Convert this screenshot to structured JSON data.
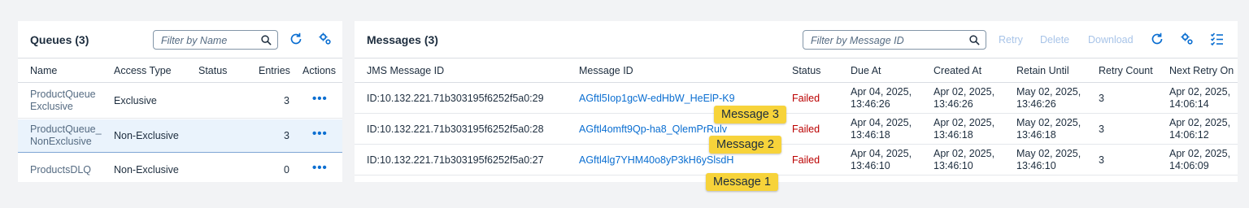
{
  "queues": {
    "title": "Queues (3)",
    "filter_placeholder": "Filter by Name",
    "columns": [
      "Name",
      "Access Type",
      "Status",
      "Entries",
      "Actions"
    ],
    "rows": [
      {
        "name_line1": "ProductQueue",
        "name_line2": "Exclusive",
        "access_type": "Exclusive",
        "status": "",
        "entries": "3",
        "actions": "•••"
      },
      {
        "name_line1": "ProductQueue_",
        "name_line2": "NonExclusive",
        "access_type": "Non-Exclusive",
        "status": "",
        "entries": "3",
        "actions": "•••"
      },
      {
        "name_line1": "ProductsDLQ",
        "name_line2": "",
        "access_type": "Non-Exclusive",
        "status": "",
        "entries": "0",
        "actions": "•••"
      }
    ]
  },
  "messages": {
    "title": "Messages (3)",
    "filter_placeholder": "Filter by Message ID",
    "actions": {
      "retry": "Retry",
      "delete": "Delete",
      "download": "Download"
    },
    "columns": [
      "JMS Message ID",
      "Message ID",
      "Status",
      "Due At",
      "Created At",
      "Retain Until",
      "Retry Count",
      "Next Retry On"
    ],
    "rows": [
      {
        "jms_id": "ID:10.132.221.71b303195f6252f5a0:29",
        "message_id": "AGftl5Iop1gcW-edHbW_HeElP-K9",
        "status": "Failed",
        "due_date": "Apr 04, 2025,",
        "due_time": "13:46:26",
        "created_date": "Apr 02, 2025,",
        "created_time": "13:46:26",
        "retain_date": "May 02, 2025,",
        "retain_time": "13:46:26",
        "retry_count": "3",
        "next_date": "Apr 02, 2025,",
        "next_time": "14:06:14"
      },
      {
        "jms_id": "ID:10.132.221.71b303195f6252f5a0:28",
        "message_id": "AGftl4omft9Qp-ha8_QlemPrRulv",
        "status": "Failed",
        "due_date": "Apr 04, 2025,",
        "due_time": "13:46:18",
        "created_date": "Apr 02, 2025,",
        "created_time": "13:46:18",
        "retain_date": "May 02, 2025,",
        "retain_time": "13:46:18",
        "retry_count": "3",
        "next_date": "Apr 02, 2025,",
        "next_time": "14:06:12"
      },
      {
        "jms_id": "ID:10.132.221.71b303195f6252f5a0:27",
        "message_id": "AGftl4lg7YHM40o8yP3kH6ySlsdH",
        "status": "Failed",
        "due_date": "Apr 04, 2025,",
        "due_time": "13:46:10",
        "created_date": "Apr 02, 2025,",
        "created_time": "13:46:10",
        "retain_date": "May 02, 2025,",
        "retain_time": "13:46:10",
        "retry_count": "3",
        "next_date": "Apr 02, 2025,",
        "next_time": "14:06:09"
      }
    ]
  },
  "callouts": [
    "Message 3",
    "Message 2",
    "Message 1"
  ],
  "colors": {
    "accent": "#0a6ed1",
    "failed": "#bb0000",
    "callout": "#f7d33a",
    "selected_row": "#eaf3fc"
  },
  "icons": [
    "search-icon",
    "refresh-icon",
    "settings-icon",
    "refresh-icon",
    "settings-icon",
    "column-settings-icon"
  ]
}
